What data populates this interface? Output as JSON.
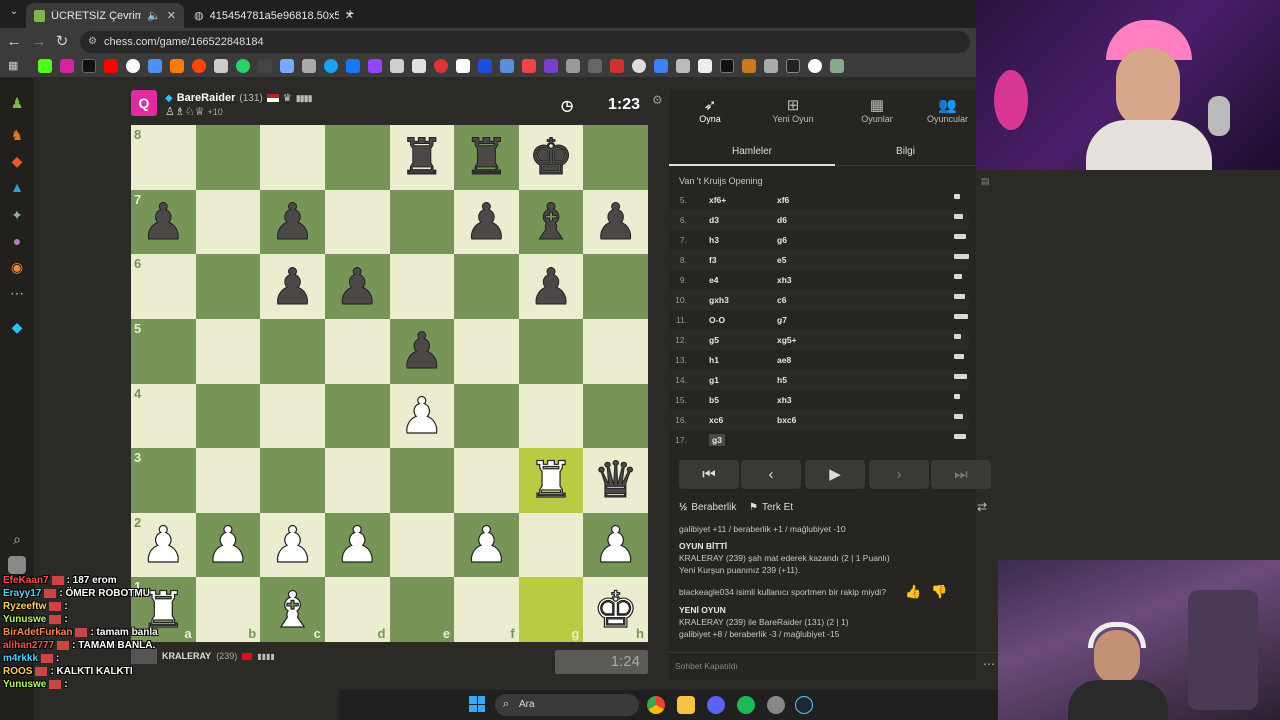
{
  "browser": {
    "tabs": [
      {
        "label": "ÜCRETSİZ Çevrimiçi Satranç"
      },
      {
        "label": "415454781a5e96818.50x50o..."
      }
    ],
    "url": "chess.com/game/166522848184"
  },
  "top_player": {
    "name": "BareRaider",
    "rating": "(131)",
    "captured_bonus": "+10",
    "clock": "1:23"
  },
  "bottom_player": {
    "name": "KRALERAY",
    "rating": "(239)",
    "clock": "1:24"
  },
  "board": {
    "ranks": [
      "8",
      "7",
      "6",
      "5",
      "4",
      "3",
      "2",
      "1"
    ],
    "files": [
      "a",
      "b",
      "c",
      "d",
      "e",
      "f",
      "g",
      "h"
    ],
    "rows": [
      [
        "",
        "",
        "",
        "",
        "r",
        "r",
        "k",
        ""
      ],
      [
        "p",
        "",
        "p",
        "",
        "",
        "p",
        "b",
        "p"
      ],
      [
        "",
        "",
        "p",
        "p",
        "",
        "",
        "p",
        ""
      ],
      [
        "",
        "",
        "",
        "",
        "p",
        "",
        "",
        ""
      ],
      [
        "",
        "",
        "",
        "",
        "P",
        "",
        "",
        ""
      ],
      [
        "",
        "",
        "",
        "",
        "",
        "",
        "R",
        "q"
      ],
      [
        "P",
        "P",
        "P",
        "P",
        "",
        "P",
        "",
        "P"
      ],
      [
        "R",
        "",
        "B",
        "",
        "",
        "",
        "",
        "K"
      ]
    ],
    "highlight": [
      "g3",
      "g1"
    ]
  },
  "panel": {
    "tabs": [
      "Oyna",
      "Yeni Oyun",
      "Oyunlar",
      "Oyuncular"
    ],
    "subtabs": [
      "Hamleler",
      "Bilgi"
    ],
    "opening": "Van 't Kruijs Opening",
    "moves": [
      {
        "n": "5.",
        "w": "xf6+",
        "b": "xf6"
      },
      {
        "n": "6.",
        "w": "d3",
        "b": "d6"
      },
      {
        "n": "7.",
        "w": "h3",
        "b": "g6"
      },
      {
        "n": "8.",
        "w": "f3",
        "b": "e5"
      },
      {
        "n": "9.",
        "w": "e4",
        "b": "xh3"
      },
      {
        "n": "10.",
        "w": "gxh3",
        "b": "c6"
      },
      {
        "n": "11.",
        "w": "O-O",
        "b": "g7"
      },
      {
        "n": "12.",
        "w": "g5",
        "b": "xg5+"
      },
      {
        "n": "13.",
        "w": "h1",
        "b": "ae8"
      },
      {
        "n": "14.",
        "w": "g1",
        "b": "h5"
      },
      {
        "n": "15.",
        "w": "b5",
        "b": "xh3"
      },
      {
        "n": "16.",
        "w": "xc6",
        "b": "bxc6"
      },
      {
        "n": "17.",
        "w": "g3",
        "b": ""
      }
    ],
    "draw_label": "Beraberlik",
    "resign_label": "Terk Et",
    "stats_line": "galibiyet +11 / beraberlik +1 / mağlubiyet -10",
    "game_over_title": "OYUN BİTTİ",
    "game_over_text": "KRALERAY (239) şah mat ederek kazandı (2 | 1 Puanlı)",
    "new_rating_text": "Yeni Kurşun puanınız 239 (+11).",
    "sportsman_question": "blackeagle034 isimli kullanıcı sportmen bir rakip miydi?",
    "new_game_title": "YENİ OYUN",
    "new_game_text": "KRALERAY (239) ile BareRaider (131) (2 | 1)",
    "new_game_stats": "galibiyet +8 / beraberlik -3 / mağlubiyet -15",
    "chat_closed": "Sohbet Kapatıldı"
  },
  "stream_chat": [
    {
      "user": "EfeKaan7",
      "msg": ": 187 erom"
    },
    {
      "user": "Erayy17",
      "msg": ": ÖMER ROBOTMU"
    },
    {
      "user": "Ryzeeftw",
      "msg": ":"
    },
    {
      "user": "Yunuswe",
      "msg": ":"
    },
    {
      "user": "BirAdetFurkan",
      "msg": ": tamam banla"
    },
    {
      "user": "alihan2777",
      "msg": ": TAMAM BANLA."
    },
    {
      "user": "m4rkkk",
      "msg": ":"
    },
    {
      "user": "ROOS",
      "msg": ": KALKTI KALKTI"
    },
    {
      "user": "Yunuswe",
      "msg": ":"
    }
  ],
  "taskbar": {
    "search_placeholder": "Ara"
  }
}
